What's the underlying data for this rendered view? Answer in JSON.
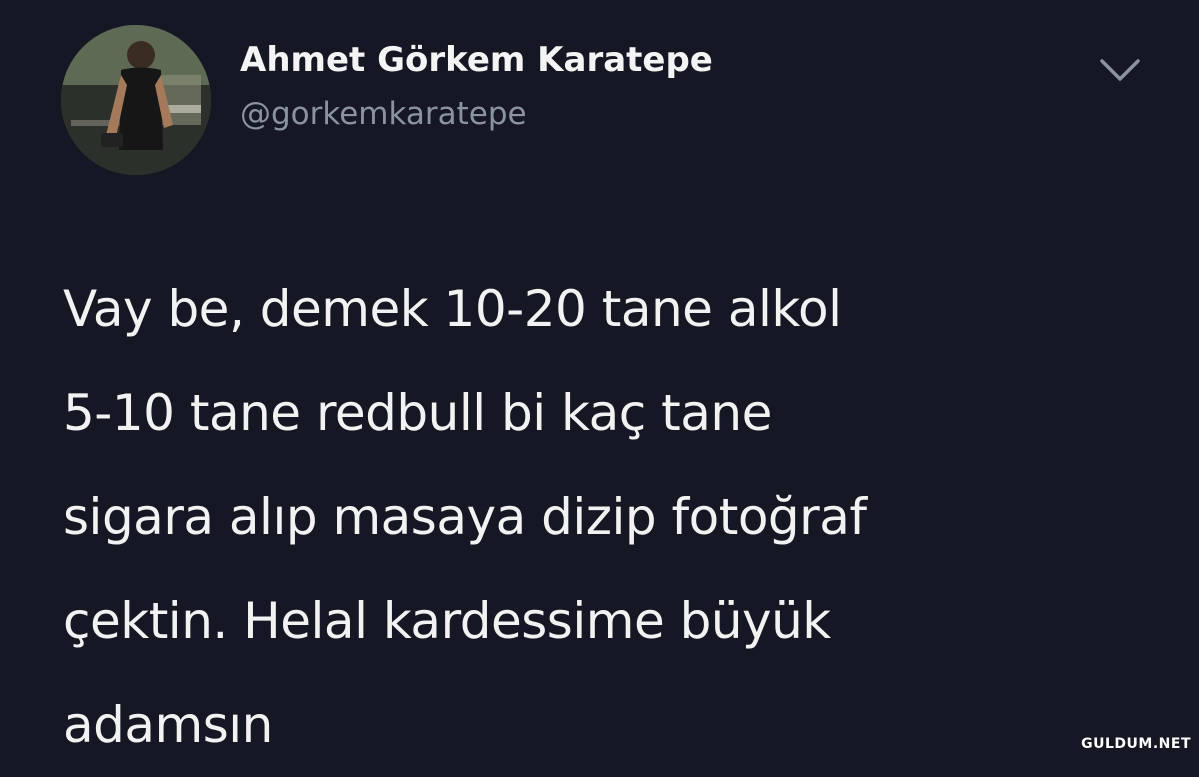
{
  "tweet": {
    "author": {
      "display_name": "Ahmet Görkem Karatepe",
      "handle": "@gorkemkaratepe",
      "avatar_icon": "gym-photo-avatar"
    },
    "menu_icon": "chevron-down-icon",
    "text": "Vay be, demek 10-20 tane alkol\n5-10 tane redbull bi kaç tane\nsigara alıp masaya dizip fotoğraf\nçektin. Helal kardessime büyük\nadamsın"
  },
  "watermark": "GULDUM.NET",
  "colors": {
    "background": "#151824",
    "text": "#f2f2f2",
    "handle": "#8b92a0",
    "chevron": "#8b92a0"
  }
}
